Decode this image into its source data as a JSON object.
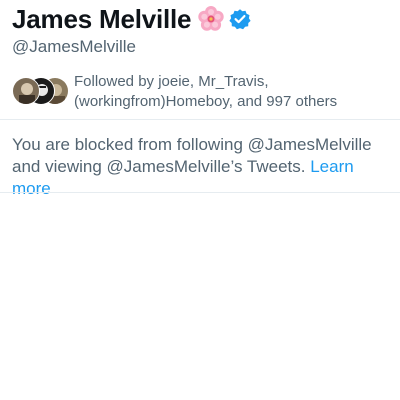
{
  "profile": {
    "display_name": "James Melville",
    "name_emoji": "flower-icon",
    "verified_icon": "verified-badge-icon",
    "handle": "@JamesMelville"
  },
  "followed_by": {
    "text": "Followed by joeie, Mr_Travis, (workingfrom)Homeboy, and 997 others",
    "avatars": [
      "avatar-1",
      "avatar-2",
      "avatar-3"
    ]
  },
  "blocked_notice": {
    "message": "You are blocked from following @JamesMelville and viewing @JamesMelville’s Tweets.",
    "link_label": "Learn more"
  },
  "colors": {
    "text_primary": "#0f1419",
    "text_secondary": "#536471",
    "link": "#1d9bf0",
    "verified": "#1d9bf0",
    "divider": "#e6ecf0"
  }
}
